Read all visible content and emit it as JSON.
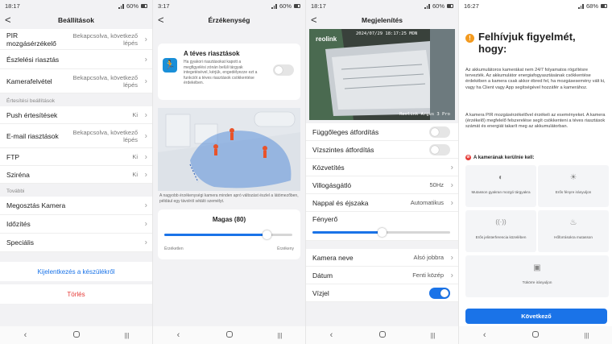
{
  "panels": [
    {
      "status": {
        "time": "18:17",
        "battery": "60%"
      },
      "header": {
        "title": "Beállítások",
        "back": "<"
      },
      "rows_top": [
        {
          "label": "PIR mozgásérzékelő",
          "value": "Bekapcsolva, következő lépés"
        },
        {
          "label": "Észlelési riasztás",
          "value": ""
        },
        {
          "label": "Kamerafelvétel",
          "value": "Bekapcsolva, következő lépés"
        }
      ],
      "section_notify": "Értesítési beállítások",
      "rows_notify": [
        {
          "label": "Push értesítések",
          "value": "Ki"
        },
        {
          "label": "E-mail riasztások",
          "value": "Bekapcsolva, következő lépés"
        },
        {
          "label": "FTP",
          "value": "Ki"
        },
        {
          "label": "Sziréna",
          "value": "Ki"
        }
      ],
      "section_more": "További",
      "rows_more": [
        {
          "label": "Megosztás Kamera"
        },
        {
          "label": "Időzítés"
        },
        {
          "label": "Speciális"
        }
      ],
      "logout": "Kijelentkezés a készülékről",
      "delete": "Törlés"
    },
    {
      "status": {
        "time": "3:17",
        "battery": "60%"
      },
      "header": {
        "title": "Érzékenység",
        "back": "<"
      },
      "false_alarm": {
        "title": "A téves riasztások",
        "desc": "Ha gyakori riasztásokat kapott a megfigyelési zónán belüli tárgyak integetésével, kérjük, engedélyezze ezt a funkciót a téves riasztások csökkentése érdekében.",
        "toggle_on": false
      },
      "scene_caption": "A nagyobb érzékenységi kamera minden apró változást észlel a látómezőben, például egy távolról sétáló személyt.",
      "sensitivity": {
        "label": "Magas (80)",
        "value": 80,
        "min_label": "Érzéketlen",
        "max_label": "Érzékeny"
      }
    },
    {
      "status": {
        "time": "18:17",
        "battery": "60%"
      },
      "header": {
        "title": "Megjelenítés",
        "back": "<"
      },
      "preview": {
        "logo": "reolink",
        "osd_top": "2024/07/29 18:17:25 MON",
        "osd_bottom": "Reolink Argus 3 Pro"
      },
      "rows": [
        {
          "label": "Függőleges átfordítás",
          "type": "toggle",
          "on": false
        },
        {
          "label": "Vízszintes átfordítás",
          "type": "toggle",
          "on": false
        },
        {
          "label": "Közvetítés",
          "type": "chevron",
          "value": ""
        },
        {
          "label": "Villogásgátló",
          "type": "chevron",
          "value": "50Hz"
        },
        {
          "label": "Nappal és éjszaka",
          "type": "chevron",
          "value": "Automatikus"
        }
      ],
      "brightness": {
        "label": "Fényerő",
        "value": 0.5
      },
      "rows_bottom": [
        {
          "label": "Kamera neve",
          "value": "Alsó jobbra"
        },
        {
          "label": "Dátum",
          "value": "Fenti közép"
        },
        {
          "label": "Vízjel",
          "type": "toggle",
          "on": true
        }
      ]
    },
    {
      "status": {
        "time": "16:27",
        "battery": "68%"
      },
      "warning": {
        "title_line1": "Felhívjuk figyelmét,",
        "title_line2": "hogy:",
        "para1": "Az akkumulátoros kamerákat nem 24/7 folyamatos rögzítésre tervezték. Az akkumulátor energiafogyasztásának csökkentése érdekében a kamera csak akkor ébred fel, ha mozgásesemény vált ki, vagy ha Client vagy App segítségével hozzáfér a kamerához.",
        "para2": "A kamera PIR mozgásérzékelővel érzékeli az eseményeket. A kamera (érzékelő) megfelelő felszerelése segít csökkenteni a téves riasztások számát és energiát takarít meg az akkumulátorban.",
        "avoid_title": "A kamerának kerülnie kell:",
        "tiles": [
          {
            "icon": "moving-object-icon",
            "glyph": "◐",
            "label": "Mutasson gyakran mozgó tárgyakra"
          },
          {
            "icon": "sun-icon",
            "glyph": "☀",
            "label": "Erős fényre irányuljon"
          },
          {
            "icon": "wifi-interference-icon",
            "glyph": "((·))",
            "label": "Erős jelinterferencia közelében"
          },
          {
            "icon": "heat-source-icon",
            "glyph": "♨",
            "label": "Hőforrásokra mutasson"
          },
          {
            "icon": "mirror-icon",
            "glyph": "▣",
            "label": "Tükörre irányuljon"
          }
        ],
        "next": "Következő"
      }
    }
  ],
  "nav": {
    "back": "‹",
    "recents": "|||"
  },
  "colors": {
    "accent": "#1a73e8",
    "warning": "#f39a1e",
    "danger": "#e53935"
  }
}
